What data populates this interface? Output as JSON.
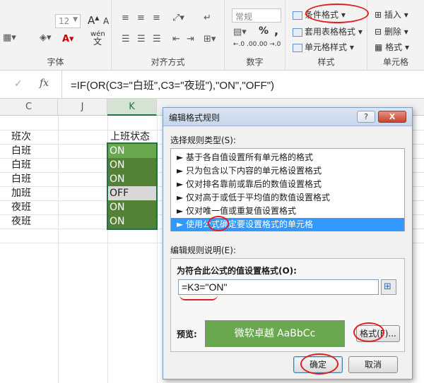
{
  "ribbon": {
    "font_group": {
      "label": "字体",
      "font_size": "12",
      "grow_label": "A",
      "shrink_label": "A",
      "wen_label": "wén",
      "wen_sub": "文"
    },
    "align_group": {
      "label": "对齐方式"
    },
    "number_group": {
      "label": "数字",
      "format_value": "常规",
      "percent": "%",
      "comma": ",",
      "inc_dec": "←.0 .00",
      "dec_dec": ".00 →.0"
    },
    "styles_group": {
      "label": "样式",
      "conditional_format": "条件格式",
      "table_format": "套用表格格式",
      "cell_styles": "单元格样式"
    },
    "cells_group": {
      "label": "单元格",
      "insert": "插入",
      "delete": "删除",
      "format": "格式"
    }
  },
  "formula_bar": {
    "cancel": "✓",
    "fx": "fx",
    "formula": "=IF(OR(C3=\"白班\",C3=\"夜班\"),\"ON\",\"OFF\")"
  },
  "sheet": {
    "columns": [
      "C",
      "J",
      "K"
    ],
    "c_values": [
      "班次",
      "白班",
      "白班",
      "白班",
      "加班",
      "夜班",
      "夜班"
    ],
    "k_header": "上班状态",
    "k_values": [
      "ON",
      "ON",
      "ON",
      "OFF",
      "ON",
      "ON"
    ]
  },
  "dialog": {
    "title": "编辑格式规则",
    "help": "?",
    "close": "X",
    "select_type_label": "选择规则类型(S):",
    "rule_types": [
      "► 基于各自值设置所有单元格的格式",
      "► 只为包含以下内容的单元格设置格式",
      "► 仅对排名靠前或靠后的数值设置格式",
      "► 仅对高于或低于平均值的数值设置格式",
      "► 仅对唯一值或重复值设置格式",
      "► 使用公式确定要设置格式的单元格"
    ],
    "edit_desc_label": "编辑规则说明(E):",
    "formula_label": "为符合此公式的值设置格式(O):",
    "formula_value": "=K3=\"ON\"",
    "preview_label": "预览:",
    "preview_text": "微软卓越  AaBbCc",
    "format_button": "格式(F)...",
    "ok_button": "确定",
    "cancel_button": "取消"
  },
  "colors": {
    "k_on_light": "#6aa84f",
    "k_on_dark": "#538135",
    "k_off": "#d9d9d9",
    "selected_rule": "#3399ff",
    "annotation_red": "#e02020"
  }
}
